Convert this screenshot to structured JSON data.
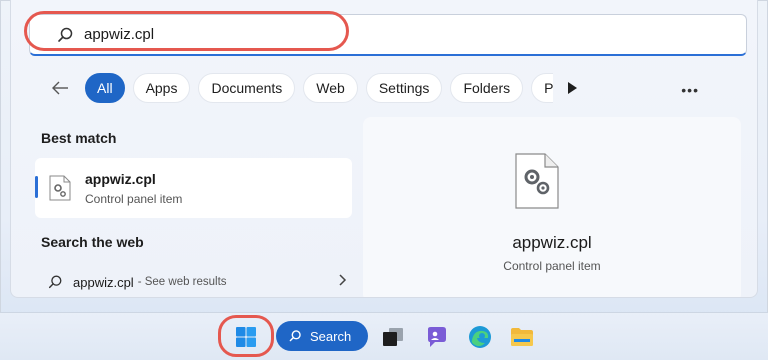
{
  "search": {
    "value": "appwiz.cpl"
  },
  "filters": {
    "chips": [
      "All",
      "Apps",
      "Documents",
      "Web",
      "Settings",
      "Folders",
      "Pho"
    ],
    "active_index": 0,
    "more_label": "•••"
  },
  "best_match": {
    "heading": "Best match",
    "name": "appwiz.cpl",
    "type": "Control panel item"
  },
  "web": {
    "heading": "Search the web",
    "term": "appwiz.cpl",
    "suffix": "- See web results"
  },
  "preview": {
    "name": "appwiz.cpl",
    "type": "Control panel item"
  },
  "taskbar": {
    "search_label": "Search",
    "icons": [
      "windows-start-icon",
      "search-icon",
      "task-view-icon",
      "teams-chat-icon",
      "edge-browser-icon",
      "file-explorer-icon"
    ]
  },
  "colors": {
    "accent": "#1f66c6",
    "highlight": "#e5584f"
  }
}
